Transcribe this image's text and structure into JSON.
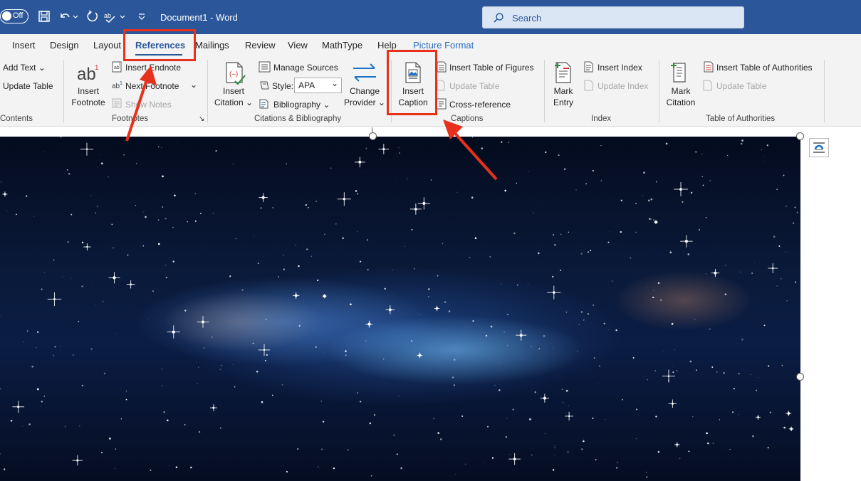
{
  "titlebar": {
    "autosave_label": "Off",
    "document_title": "Document1  -  Word",
    "search_placeholder": "Search"
  },
  "tabs": [
    {
      "label": "Insert"
    },
    {
      "label": "Design"
    },
    {
      "label": "Layout"
    },
    {
      "label": "References"
    },
    {
      "label": "Mailings"
    },
    {
      "label": "Review"
    },
    {
      "label": "View"
    },
    {
      "label": "MathType"
    },
    {
      "label": "Help"
    },
    {
      "label": "Picture Format"
    }
  ],
  "ribbon": {
    "contents": {
      "add_text": "Add Text",
      "update_table": "Update Table",
      "group_label": "Contents"
    },
    "footnotes": {
      "insert_footnote_line1": "Insert",
      "insert_footnote_line2": "Footnote",
      "insert_endnote": "Insert Endnote",
      "next_footnote": "Next Footnote",
      "show_notes": "Show Notes",
      "group_label": "Footnotes"
    },
    "citations": {
      "insert_citation_line1": "Insert",
      "insert_citation_line2": "Citation",
      "manage_sources": "Manage Sources",
      "style_label": "Style:",
      "style_value": "APA",
      "bibliography": "Bibliography",
      "change_provider_line1": "Change",
      "change_provider_line2": "Provider",
      "group_label": "Citations & Bibliography"
    },
    "captions": {
      "insert_caption_line1": "Insert",
      "insert_caption_line2": "Caption",
      "insert_table_of_figures": "Insert Table of Figures",
      "update_table": "Update Table",
      "cross_reference": "Cross-reference",
      "group_label": "Captions"
    },
    "index": {
      "mark_entry_line1": "Mark",
      "mark_entry_line2": "Entry",
      "insert_index": "Insert Index",
      "update_index": "Update Index",
      "group_label": "Index"
    },
    "authorities": {
      "mark_citation_line1": "Mark",
      "mark_citation_line2": "Citation",
      "insert_table_of_authorities": "Insert Table of Authorities",
      "update_table": "Update Table",
      "group_label": "Table of Authorities"
    }
  },
  "colors": {
    "word_blue": "#2b579a",
    "highlight_red": "#e8311b",
    "ribbon_bg": "#f3f3f3"
  }
}
